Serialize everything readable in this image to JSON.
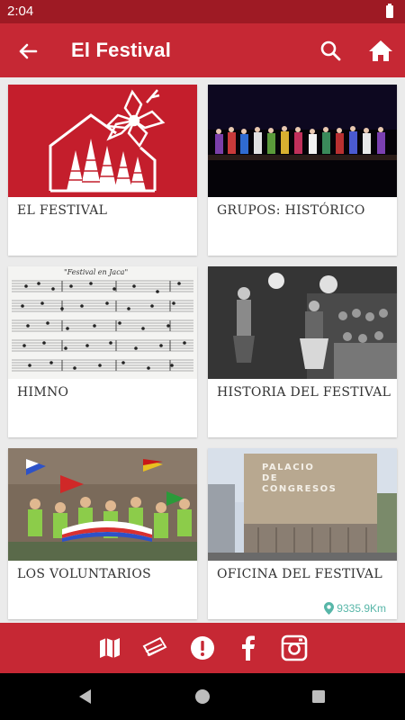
{
  "status_bar": {
    "time": "2:04"
  },
  "app_bar": {
    "title": "El Festival"
  },
  "cards": [
    {
      "label": "EL FESTIVAL"
    },
    {
      "label": "GRUPOS: HISTÓRICO"
    },
    {
      "label": "HIMNO"
    },
    {
      "label": "HISTORIA DEL FESTIVAL"
    },
    {
      "label": "LOS VOLUNTARIOS"
    },
    {
      "label": "OFICINA DEL FESTIVAL",
      "distance": "9335.9Km"
    }
  ],
  "himno_sheet": {
    "title": "\"Festival en Jaca\""
  },
  "oficina_photo": {
    "sign_line1": "PALACIO",
    "sign_line2": "DE",
    "sign_line3": "CONGRESOS"
  },
  "bottom_bar": {
    "icons": [
      "map-icon",
      "tickets-icon",
      "alert-icon",
      "facebook-icon",
      "instagram-icon"
    ]
  },
  "colors": {
    "primary": "#c62834",
    "status": "#9e1a24",
    "distance": "#57b6a8"
  }
}
